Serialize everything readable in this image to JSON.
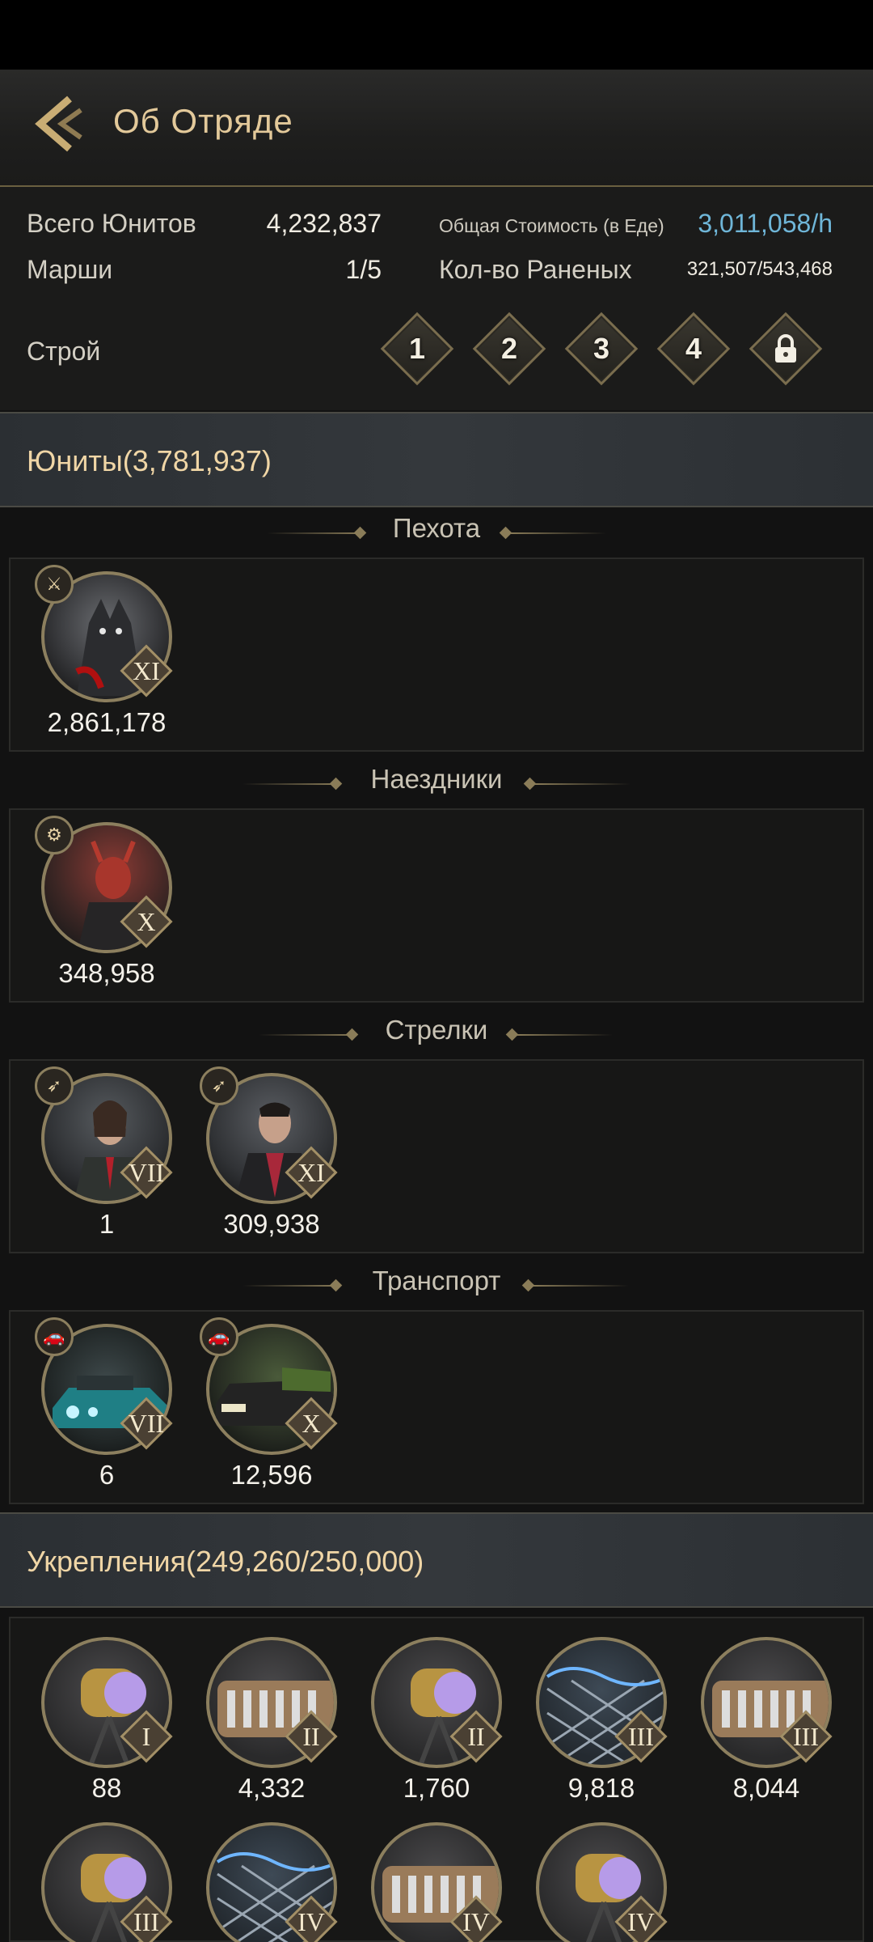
{
  "header": {
    "title": "Об Отряде"
  },
  "stats": {
    "total_units_label": "Всего Юнитов",
    "total_units_value": "4,232,837",
    "total_cost_label": "Общая Стоимость (в Еде)",
    "total_cost_value": "3,011,058/h",
    "marches_label": "Марши",
    "marches_value": "1/5",
    "wounded_label": "Кол-во Раненых",
    "wounded_value": "321,507/543,468",
    "formation_label": "Строй",
    "formations": [
      "1",
      "2",
      "3",
      "4"
    ]
  },
  "units_section": {
    "label": "Юниты(3,781,937)"
  },
  "infantry": {
    "title": "Пехота",
    "units": [
      {
        "tier": "XI",
        "count": "2,861,178",
        "icon": "infantry-icon"
      }
    ]
  },
  "riders": {
    "title": "Наездники",
    "units": [
      {
        "tier": "X",
        "count": "348,958",
        "icon": "rider-icon"
      }
    ]
  },
  "shooters": {
    "title": "Стрелки",
    "units": [
      {
        "tier": "VII",
        "count": "1",
        "icon": "shooter-icon"
      },
      {
        "tier": "XI",
        "count": "309,938",
        "icon": "shooter-icon"
      }
    ]
  },
  "transport": {
    "title": "Транспорт",
    "units": [
      {
        "tier": "VII",
        "count": "6",
        "icon": "vehicle-icon"
      },
      {
        "tier": "X",
        "count": "12,596",
        "icon": "vehicle-icon"
      }
    ]
  },
  "fortifications_section": {
    "label": "Укрепления(249,260/250,000)"
  },
  "fortifications": {
    "row1": [
      {
        "tier": "I",
        "count": "88",
        "icon": "searchlight-icon"
      },
      {
        "tier": "II",
        "count": "4,332",
        "icon": "barricade-icon"
      },
      {
        "tier": "II",
        "count": "1,760",
        "icon": "searchlight-icon"
      },
      {
        "tier": "III",
        "count": "9,818",
        "icon": "wire-fence-icon"
      },
      {
        "tier": "III",
        "count": "8,044",
        "icon": "barricade-icon"
      }
    ],
    "row2": [
      {
        "tier": "III",
        "icon": "searchlight-icon"
      },
      {
        "tier": "IV",
        "icon": "wire-fence-icon"
      },
      {
        "tier": "IV",
        "icon": "barricade-icon"
      },
      {
        "tier": "IV",
        "icon": "searchlight-icon"
      }
    ]
  },
  "colors": {
    "accent_gold": "#e3c99a",
    "cost_blue": "#6fb6d8"
  }
}
